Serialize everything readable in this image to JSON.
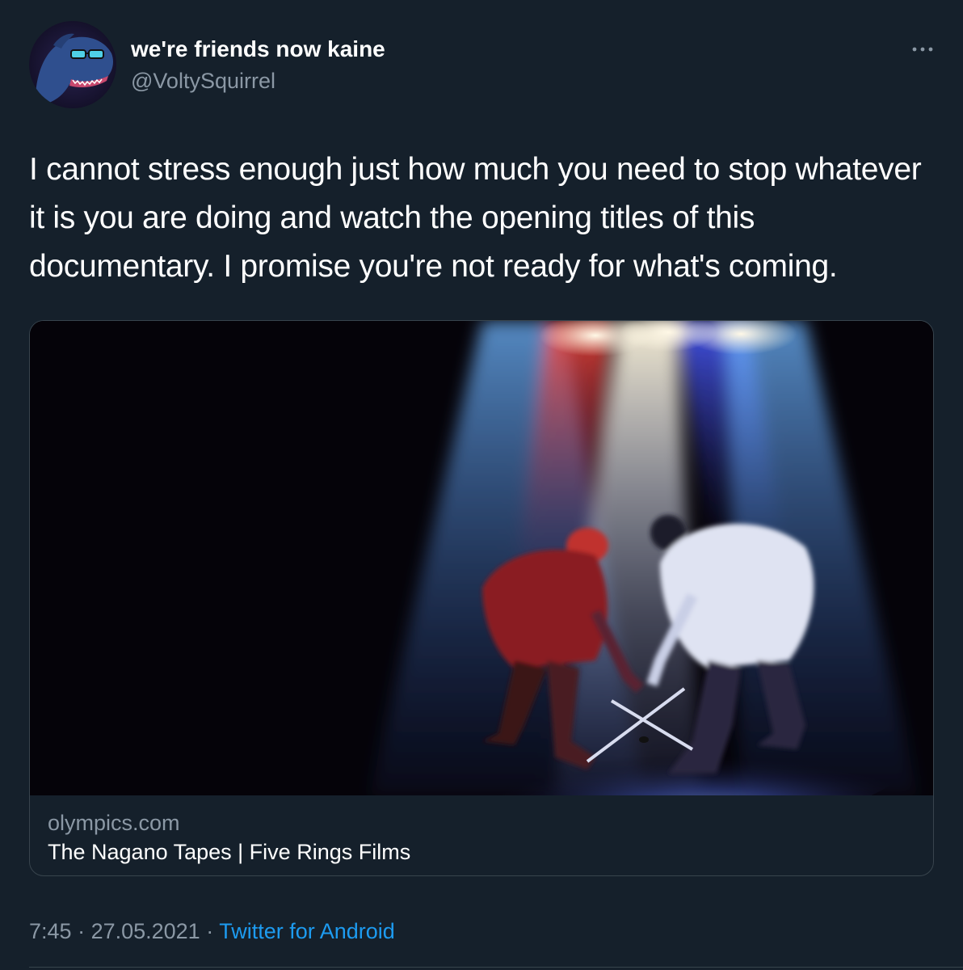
{
  "tweet": {
    "author": {
      "display_name": "we're friends now kaine",
      "handle": "@VoltySquirrel",
      "avatar_icon": "dinosaur-avatar-icon"
    },
    "more_icon": "more-options-icon",
    "text": "I cannot stress enough just how much you need to stop whatever it is you are doing and watch the opening titles of this documentary. I promise you're not ready for what's coming.",
    "card": {
      "image_description_icon": "hockey-faceoff-image",
      "domain": "olympics.com",
      "title": "The Nagano Tapes | Five Rings Films"
    },
    "meta": {
      "time": "7:45",
      "separator": " · ",
      "date": "27.05.2021",
      "source": "Twitter for Android"
    }
  },
  "colors": {
    "background": "#15202b",
    "secondary_text": "#8b98a5",
    "link": "#1d9bf0",
    "border": "#38444d"
  }
}
